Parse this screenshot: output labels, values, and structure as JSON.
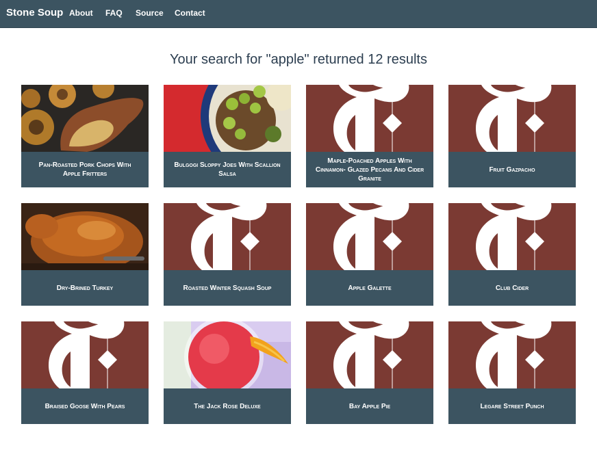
{
  "nav": {
    "brand": "Stone Soup",
    "links": [
      "About",
      "FAQ",
      "Source",
      "Contact"
    ]
  },
  "search": {
    "heading": "Your search for \"apple\" returned 12 results"
  },
  "colors": {
    "navbar": "#3c5461",
    "caption_bg": "#3c5461",
    "placeholder_bg": "#7b3a33",
    "heading_text": "#2c3e50"
  },
  "results": [
    {
      "title": "Pan-Roasted Pork Chops With Apple Fritters",
      "image": "pork-chop-photo"
    },
    {
      "title": "Bulgogi Sloppy Joes With Scallion Salsa",
      "image": "sloppy-joes-photo"
    },
    {
      "title": "Maple-Poached Apples With Cinnamon- Glazed Pecans And Cider Granite",
      "image": "nyt-logo-placeholder"
    },
    {
      "title": "Fruit Gazpacho",
      "image": "nyt-logo-placeholder"
    },
    {
      "title": "Dry-Brined Turkey",
      "image": "roast-turkey-photo"
    },
    {
      "title": "Roasted Winter Squash Soup",
      "image": "nyt-logo-placeholder"
    },
    {
      "title": "Apple Galette",
      "image": "nyt-logo-placeholder"
    },
    {
      "title": "Club Cider",
      "image": "nyt-logo-placeholder"
    },
    {
      "title": "Braised Goose With Pears",
      "image": "nyt-logo-placeholder"
    },
    {
      "title": "The Jack Rose Deluxe",
      "image": "cocktail-photo"
    },
    {
      "title": "Bay Apple Pie",
      "image": "nyt-logo-placeholder"
    },
    {
      "title": "Legare Street Punch",
      "image": "nyt-logo-placeholder"
    }
  ]
}
